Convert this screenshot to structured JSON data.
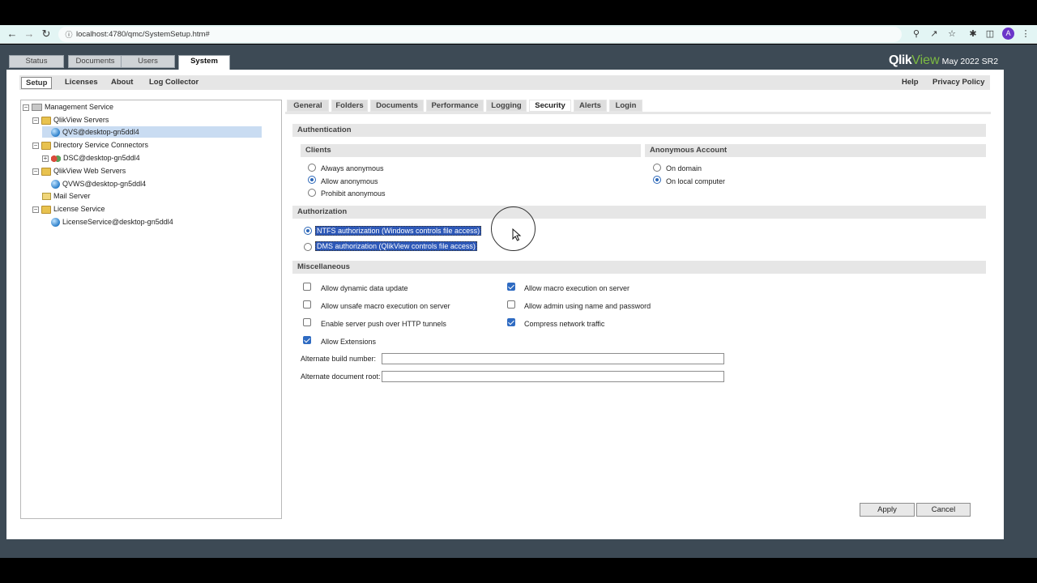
{
  "browser": {
    "url": "localhost:4780/qmc/SystemSetup.htm#",
    "avatar_letter": "A"
  },
  "app": {
    "top_tabs": [
      {
        "label": "Status"
      },
      {
        "label": "Documents"
      },
      {
        "label": "Users"
      },
      {
        "label": "System"
      }
    ],
    "logo": {
      "qlik": "Qlik",
      "view": "View",
      "version": "May 2022 SR2"
    },
    "sub_nav": {
      "left": [
        {
          "label": "Setup"
        },
        {
          "label": "Licenses"
        },
        {
          "label": "About"
        },
        {
          "label": "Log Collector"
        }
      ],
      "right": [
        {
          "label": "Help"
        },
        {
          "label": "Privacy Policy"
        }
      ]
    },
    "tree": [
      {
        "label": "Management Service"
      },
      {
        "label": "QlikView Servers"
      },
      {
        "label": "QVS@desktop-gn5ddl4"
      },
      {
        "label": "Directory Service Connectors"
      },
      {
        "label": "DSC@desktop-gn5ddl4"
      },
      {
        "label": "QlikView Web Servers"
      },
      {
        "label": "QVWS@desktop-gn5ddl4"
      },
      {
        "label": "Mail Server"
      },
      {
        "label": "License Service"
      },
      {
        "label": "LicenseService@desktop-gn5ddl4"
      }
    ],
    "content_tabs": [
      {
        "label": "General"
      },
      {
        "label": "Folders"
      },
      {
        "label": "Documents"
      },
      {
        "label": "Performance"
      },
      {
        "label": "Logging"
      },
      {
        "label": "Security"
      },
      {
        "label": "Alerts"
      },
      {
        "label": "Login"
      }
    ],
    "authentication": {
      "title": "Authentication",
      "clients_title": "Clients",
      "clients": [
        {
          "label": "Always anonymous",
          "selected": false
        },
        {
          "label": "Allow anonymous",
          "selected": true
        },
        {
          "label": "Prohibit anonymous",
          "selected": false
        }
      ],
      "anon_title": "Anonymous Account",
      "anon": [
        {
          "label": "On domain",
          "selected": false
        },
        {
          "label": "On local computer",
          "selected": true
        }
      ]
    },
    "authorization": {
      "title": "Authorization",
      "options": [
        {
          "label": "NTFS authorization (Windows controls file access)",
          "selected": true
        },
        {
          "label": "DMS authorization (QlikView controls file access)",
          "selected": false
        }
      ]
    },
    "misc": {
      "title": "Miscellaneous",
      "checks": [
        {
          "label": "Allow dynamic data update",
          "checked": false
        },
        {
          "label": "Allow macro execution on server",
          "checked": true
        },
        {
          "label": "Allow unsafe macro execution on server",
          "checked": false
        },
        {
          "label": "Allow admin using name and password",
          "checked": false
        },
        {
          "label": "Enable server push over HTTP tunnels",
          "checked": false
        },
        {
          "label": "Compress network traffic",
          "checked": true
        },
        {
          "label": "Allow Extensions",
          "checked": true
        }
      ],
      "alt_build_label": "Alternate build number:",
      "alt_build_value": "",
      "alt_root_label": "Alternate document root:",
      "alt_root_value": ""
    },
    "buttons": {
      "apply": "Apply",
      "cancel": "Cancel"
    }
  }
}
